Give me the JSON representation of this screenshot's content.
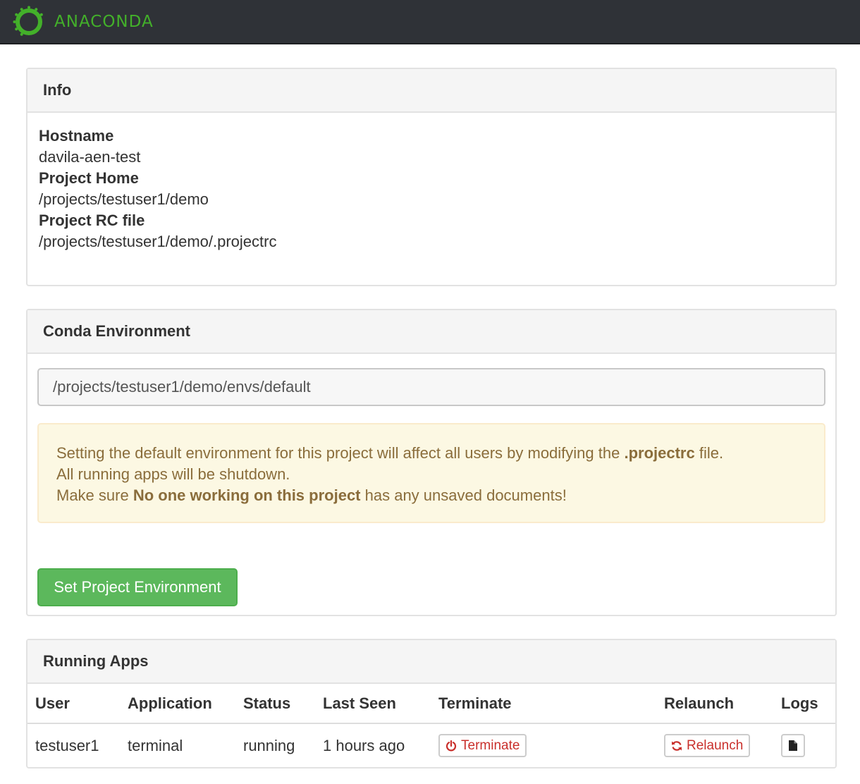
{
  "header": {
    "brand": "ANACONDA",
    "brand_color": "#43b02a",
    "logo_icon": "anaconda-ring-icon"
  },
  "info": {
    "title": "Info",
    "fields": [
      {
        "label": "Hostname",
        "value": "davila-aen-test"
      },
      {
        "label": "Project Home",
        "value": "/projects/testuser1/demo"
      },
      {
        "label": "Project RC file",
        "value": "/projects/testuser1/demo/.projectrc"
      }
    ]
  },
  "conda": {
    "title": "Conda Environment",
    "env_path": "/projects/testuser1/demo/envs/default",
    "alert": {
      "line1_pre": "Setting the default environment for this project will affect all users by modifying the ",
      "line1_bold": ".projectrc",
      "line1_post": " file.",
      "line2": "All running apps will be shutdown.",
      "line3_pre": "Make sure ",
      "line3_bold": "No one working on this project",
      "line3_post": " has any unsaved documents!"
    },
    "set_button": "Set Project Environment"
  },
  "apps": {
    "title": "Running Apps",
    "columns": [
      "User",
      "Application",
      "Status",
      "Last Seen",
      "Terminate",
      "Relaunch",
      "Logs"
    ],
    "rows": [
      {
        "user": "testuser1",
        "application": "terminal",
        "status": "running",
        "last_seen": "1 hours ago",
        "terminate_label": "Terminate",
        "relaunch_label": "Relaunch"
      }
    ]
  },
  "icons": {
    "terminate": "power-icon",
    "relaunch": "refresh-icon",
    "logs": "file-icon"
  },
  "colors": {
    "danger": "#c9302c",
    "success": "#5cb85c",
    "warning_text": "#8a6d3b",
    "warning_bg": "#fcf8e3"
  }
}
